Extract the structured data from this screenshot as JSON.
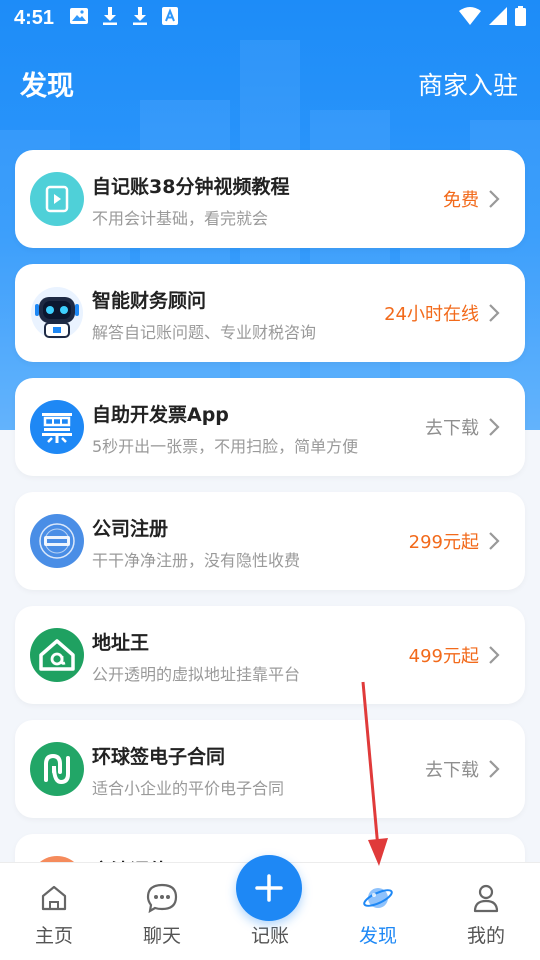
{
  "status_bar": {
    "time": "4:51"
  },
  "header": {
    "title": "发现",
    "merchant_link": "商家入驻"
  },
  "colors": {
    "brand_blue": "#1e88f5",
    "price_orange": "#f26a1b",
    "muted_gray": "#8f8f8f",
    "annotation_red": "#e03a3a"
  },
  "cards": [
    {
      "name": "自记账38分钟视频教程",
      "desc": "不用会计基础，看完就会",
      "action": "免费",
      "action_style": "orange",
      "icon": "video-play-icon"
    },
    {
      "name": "智能财务顾问",
      "desc": "解答自记账问题、专业财税咨询",
      "action": "24小时在线",
      "action_style": "orange",
      "icon": "robot-icon"
    },
    {
      "name": "自助开发票App",
      "desc": "5秒开出一张票，不用扫脸，简单方便",
      "action": "去下载",
      "action_style": "gray",
      "icon": "invoice-icon"
    },
    {
      "name": "公司注册",
      "desc": "干干净净注册，没有隐性收费",
      "action": "299元起",
      "action_style": "orange",
      "icon": "registration-stamp-icon"
    },
    {
      "name": "地址王",
      "desc": "公开透明的虚拟地址挂靠平台",
      "action": "499元起",
      "action_style": "orange",
      "icon": "address-house-icon"
    },
    {
      "name": "环球签电子合同",
      "desc": "适合小企业的平价电子合同",
      "action": "去下载",
      "action_style": "gray",
      "icon": "esign-icon"
    },
    {
      "name": "商法评估",
      "desc": "",
      "action": "",
      "action_style": "gray",
      "icon": "partial-icon"
    }
  ],
  "tabbar": {
    "tabs": [
      {
        "label": "主页",
        "icon": "home-icon"
      },
      {
        "label": "聊天",
        "icon": "chat-icon"
      },
      {
        "label": "记账",
        "icon": "plus-icon"
      },
      {
        "label": "发现",
        "icon": "planet-icon",
        "active": true
      },
      {
        "label": "我的",
        "icon": "profile-icon"
      }
    ]
  }
}
